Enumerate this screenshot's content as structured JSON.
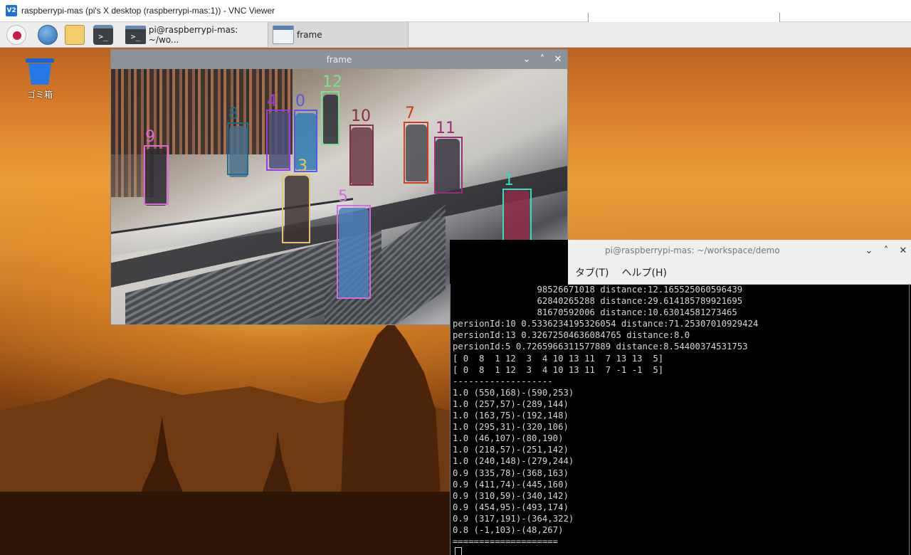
{
  "vnc": {
    "title": "raspberrypi-mas (pi's X desktop (raspberrypi-mas:1)) - VNC Viewer",
    "logo": "V2"
  },
  "taskbar": {
    "terminal_task": "pi@raspberrypi-mas: ~/wo...",
    "frame_task": "frame"
  },
  "desktop": {
    "trash_label": "ゴミ箱"
  },
  "frame_window": {
    "title": "frame",
    "controls": [
      "⌄",
      "˄",
      "✕"
    ],
    "detections": [
      {
        "id": "0",
        "color": "#5b57e0"
      },
      {
        "id": "1",
        "color": "#2fe0c4"
      },
      {
        "id": "3",
        "color": "#e6c36b"
      },
      {
        "id": "4",
        "color": "#9a38e6"
      },
      {
        "id": "5",
        "color": "#d36be6"
      },
      {
        "id": "7",
        "color": "#d63b1d"
      },
      {
        "id": "8",
        "color": "#1f6d8c"
      },
      {
        "id": "9",
        "color": "#de6ad8"
      },
      {
        "id": "10",
        "color": "#8c2e3f"
      },
      {
        "id": "11",
        "color": "#9a2e78"
      },
      {
        "id": "12",
        "color": "#7de08a"
      }
    ]
  },
  "terminal": {
    "title": "pi@raspberrypi-mas: ~/workspace/demo",
    "menu": [
      "タブ(T)",
      "ヘルプ(H)"
    ],
    "controls": [
      "⌄",
      "˄",
      "✕"
    ],
    "lines": [
      "                98526671018 distance:12.165525060596439",
      "                62840265288 distance:29.614185789921695",
      "                81670592006 distance:10.63014581273465",
      "persionId:10 0.5336234195326054 distance:71.25307010929424",
      "persionId:13 0.32672504636084765 distance:8.0",
      "persionId:5 0.7265966311577889 distance:8.54400374531753",
      "[ 0  8  1 12  3  4 10 13 11  7 13 13  5]",
      "[ 0  8  1 12  3  4 10 13 11  7 -1 -1  5]",
      "-------------------",
      "1.0 (550,168)-(590,253)",
      "1.0 (257,57)-(289,144)",
      "1.0 (163,75)-(192,148)",
      "1.0 (295,31)-(320,106)",
      "1.0 (46,107)-(80,190)",
      "1.0 (218,57)-(251,142)",
      "1.0 (240,148)-(279,244)",
      "0.9 (335,78)-(368,163)",
      "0.9 (411,74)-(445,160)",
      "0.9 (310,59)-(340,142)",
      "0.9 (454,95)-(493,174)",
      "0.9 (317,191)-(364,322)",
      "0.8 (-1,103)-(48,267)",
      "===================="
    ]
  }
}
